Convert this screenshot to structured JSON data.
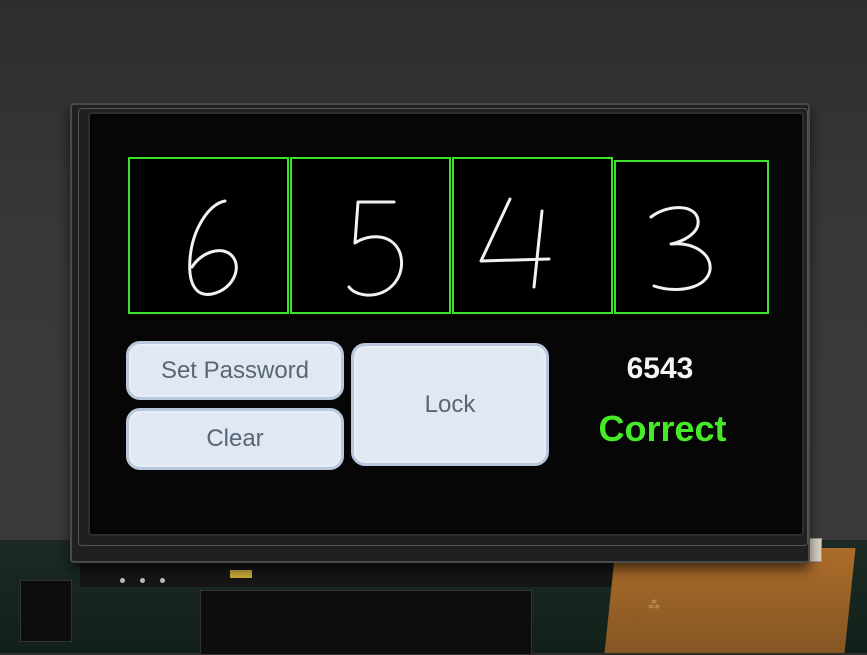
{
  "digits": [
    "6",
    "5",
    "4",
    "3"
  ],
  "buttons": {
    "set_password": "Set Password",
    "clear": "Clear",
    "lock": "Lock"
  },
  "entered_code": "6543",
  "status": "Correct",
  "colors": {
    "box_border": "#3ee22b",
    "status_text": "#47ea28",
    "button_bg": "#dfe8f3",
    "button_text": "#5a6676"
  }
}
